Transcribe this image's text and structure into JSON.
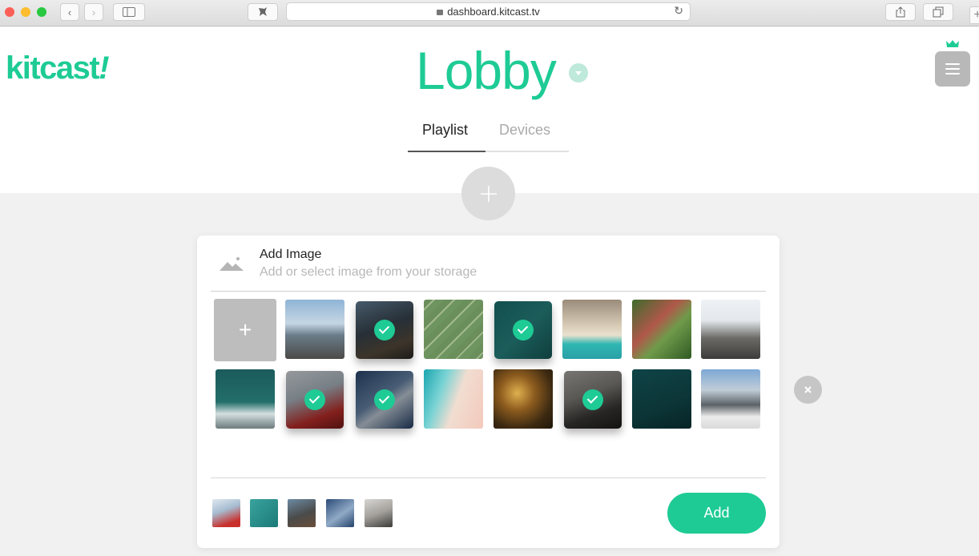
{
  "browser": {
    "url": "dashboard.kitcast.tv",
    "back_label": "‹",
    "forward_label": "›"
  },
  "header": {
    "logo": "kitcast",
    "logo_mark": "!",
    "title": "Lobby",
    "menu_icon": "hamburger-icon"
  },
  "tabs": [
    {
      "label": "Playlist",
      "active": true
    },
    {
      "label": "Devices",
      "active": false
    }
  ],
  "add_panel": {
    "title": "Add Image",
    "subtitle": "Add or select image from your storage",
    "add_tile_label": "+",
    "images": [
      {
        "subject": "hiker on mountain",
        "selected": false
      },
      {
        "subject": "climber at dusk",
        "selected": true
      },
      {
        "subject": "aerial field",
        "selected": false
      },
      {
        "subject": "teal water aerial",
        "selected": true
      },
      {
        "subject": "beach from above",
        "selected": false
      },
      {
        "subject": "tennis court aerial",
        "selected": false
      },
      {
        "subject": "snowy summit",
        "selected": false
      },
      {
        "subject": "ocean wave",
        "selected": false
      },
      {
        "subject": "red jacket climber",
        "selected": true
      },
      {
        "subject": "ice climbers",
        "selected": true
      },
      {
        "subject": "turquoise shoreline",
        "selected": false
      },
      {
        "subject": "city lights aerial",
        "selected": false
      },
      {
        "subject": "rock climber",
        "selected": true
      },
      {
        "subject": "dark sea with boat",
        "selected": false
      },
      {
        "subject": "snow mountain hiker",
        "selected": false
      }
    ],
    "selected_thumbs": [
      "red jacket climber",
      "teal water aerial",
      "climber at dusk",
      "ice climbers",
      "rock climber"
    ],
    "add_button": "Add"
  },
  "colors": {
    "accent": "#1ecb95"
  }
}
